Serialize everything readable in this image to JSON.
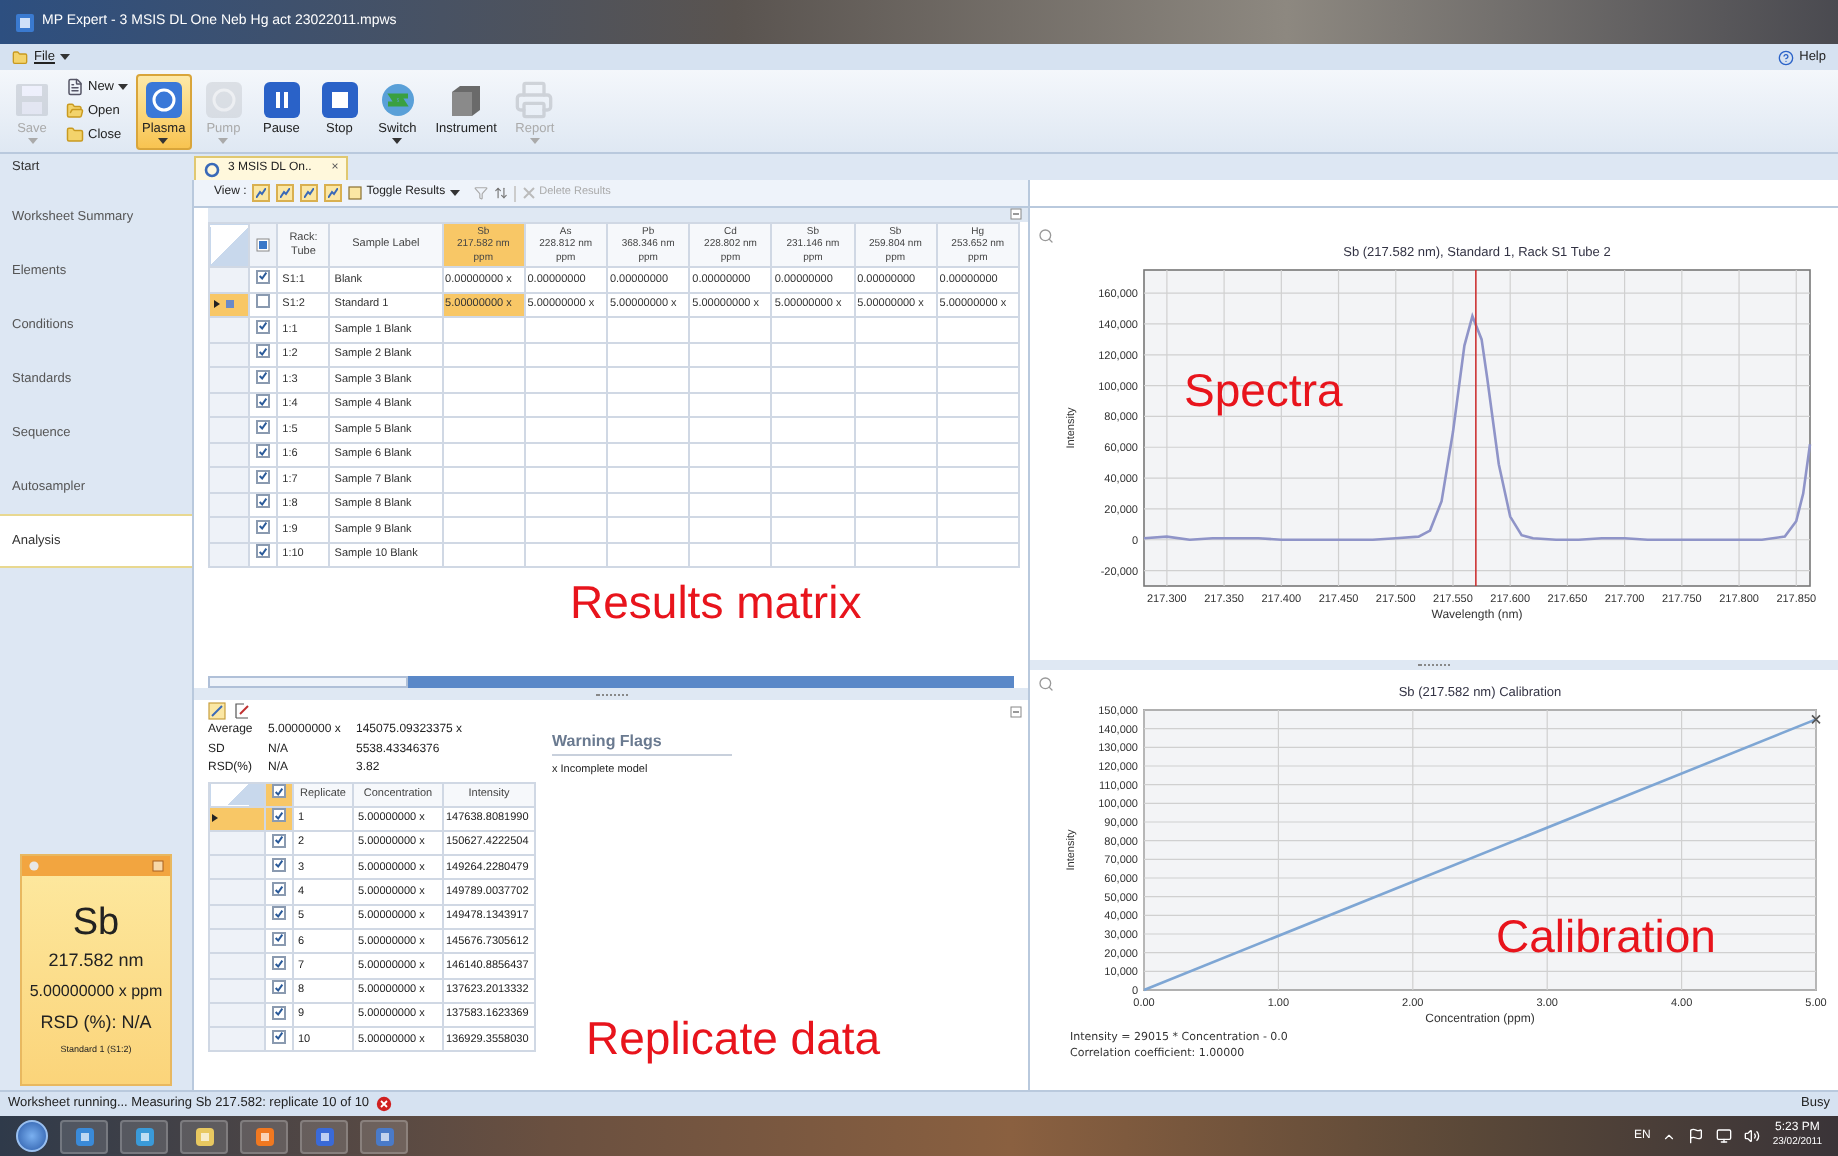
{
  "window": {
    "title": "MP Expert - 3 MSIS DL One Neb Hg act 23022011.mpws"
  },
  "menu": {
    "file": "File",
    "help": "Help"
  },
  "ribbon": {
    "buttons": [
      {
        "label": "Save",
        "kind": "large",
        "disabled": true,
        "selected": false,
        "dropdown": true
      },
      {
        "label": "New",
        "kind": "small",
        "disabled": false,
        "selected": false,
        "dropdown": true
      },
      {
        "label": "Open",
        "kind": "small",
        "disabled": false,
        "selected": false,
        "dropdown": false
      },
      {
        "label": "Close",
        "kind": "small",
        "disabled": false,
        "selected": false,
        "dropdown": false
      },
      {
        "label": "Plasma",
        "kind": "large",
        "disabled": false,
        "selected": true,
        "dropdown": true
      },
      {
        "label": "Pump",
        "kind": "large",
        "disabled": true,
        "selected": false,
        "dropdown": true
      },
      {
        "label": "Pause",
        "kind": "large",
        "disabled": false,
        "selected": false,
        "dropdown": false
      },
      {
        "label": "Stop",
        "kind": "large",
        "disabled": false,
        "selected": false,
        "dropdown": false
      },
      {
        "label": "Switch",
        "kind": "large",
        "disabled": false,
        "selected": false,
        "dropdown": true
      },
      {
        "label": "Instrument",
        "kind": "large",
        "disabled": false,
        "selected": false,
        "dropdown": false
      },
      {
        "label": "Report",
        "kind": "large",
        "disabled": true,
        "selected": false,
        "dropdown": true
      }
    ],
    "group_label": "Start"
  },
  "document_tab": {
    "label": "3 MSIS DL On..",
    "close": "×"
  },
  "sidebar": {
    "items": [
      {
        "label": "Worksheet Summary",
        "selected": false
      },
      {
        "label": "Elements",
        "selected": false
      },
      {
        "label": "Conditions",
        "selected": false
      },
      {
        "label": "Standards",
        "selected": false
      },
      {
        "label": "Sequence",
        "selected": false
      },
      {
        "label": "Autosampler",
        "selected": false
      },
      {
        "label": "Analysis",
        "selected": true
      }
    ]
  },
  "info_card": {
    "element": "Sb",
    "wavelength": "217.582 nm",
    "concentration": "5.00000000 x ppm",
    "rsd": "RSD (%): N/A",
    "sample": "Standard 1 (S1:2)"
  },
  "view_toolbar": {
    "label": "View :",
    "toggle": "Toggle Results",
    "delete": {
      "label": "Delete Results",
      "disabled": true
    }
  },
  "results": {
    "columns": [
      {
        "kind": "text",
        "label": "Rack: Tube"
      },
      {
        "kind": "text",
        "label": "Sample Label"
      },
      {
        "kind": "element",
        "element": "Sb",
        "wavelength": "217.582 nm",
        "unit": "ppm",
        "selected": true
      },
      {
        "kind": "element",
        "element": "As",
        "wavelength": "228.812 nm",
        "unit": "ppm",
        "selected": false
      },
      {
        "kind": "element",
        "element": "Pb",
        "wavelength": "368.346 nm",
        "unit": "ppm",
        "selected": false
      },
      {
        "kind": "element",
        "element": "Cd",
        "wavelength": "228.802 nm",
        "unit": "ppm",
        "selected": false
      },
      {
        "kind": "element",
        "element": "Sb",
        "wavelength": "231.146 nm",
        "unit": "ppm",
        "selected": false
      },
      {
        "kind": "element",
        "element": "Sb",
        "wavelength": "259.804 nm",
        "unit": "ppm",
        "selected": false
      },
      {
        "kind": "element",
        "element": "Hg",
        "wavelength": "253.652 nm",
        "unit": "ppm",
        "selected": false
      }
    ],
    "rows": [
      {
        "current": false,
        "checked": true,
        "rack": "S1:1",
        "label": "Blank",
        "values": [
          "0.00000000 x",
          "0.00000000",
          "0.00000000",
          "0.00000000",
          "0.00000000",
          "0.00000000",
          "0.00000000"
        ]
      },
      {
        "current": true,
        "checked": false,
        "rack": "S1:2",
        "label": "Standard 1",
        "values": [
          "5.00000000 x",
          "5.00000000 x",
          "5.00000000 x",
          "5.00000000 x",
          "5.00000000 x",
          "5.00000000 x",
          "5.00000000 x"
        ]
      },
      {
        "current": false,
        "checked": true,
        "rack": "1:1",
        "label": "Sample 1 Blank"
      },
      {
        "current": false,
        "checked": true,
        "rack": "1:2",
        "label": "Sample 2 Blank"
      },
      {
        "current": false,
        "checked": true,
        "rack": "1:3",
        "label": "Sample 3 Blank"
      },
      {
        "current": false,
        "checked": true,
        "rack": "1:4",
        "label": "Sample 4 Blank"
      },
      {
        "current": false,
        "checked": true,
        "rack": "1:5",
        "label": "Sample 5 Blank"
      },
      {
        "current": false,
        "checked": true,
        "rack": "1:6",
        "label": "Sample 6 Blank"
      },
      {
        "current": false,
        "checked": true,
        "rack": "1:7",
        "label": "Sample 7 Blank"
      },
      {
        "current": false,
        "checked": true,
        "rack": "1:8",
        "label": "Sample 8 Blank"
      },
      {
        "current": false,
        "checked": true,
        "rack": "1:9",
        "label": "Sample 9 Blank"
      },
      {
        "current": false,
        "checked": true,
        "rack": "1:10",
        "label": "Sample 10 Blank"
      }
    ]
  },
  "replicates": {
    "stats": [
      {
        "label": "Average",
        "concentration": "5.00000000 x",
        "intensity": "145075.09323375 x"
      },
      {
        "label": "SD",
        "concentration": "N/A",
        "intensity": "5538.43346376"
      },
      {
        "label": "RSD(%)",
        "concentration": "N/A",
        "intensity": "3.82"
      }
    ],
    "all_checked": true,
    "columns": [
      "Replicate",
      "Concentration",
      "Intensity"
    ],
    "rows": [
      {
        "current": true,
        "checked": true,
        "replicate": "1",
        "concentration": "5.00000000 x",
        "intensity": "147638.8081990"
      },
      {
        "current": false,
        "checked": true,
        "replicate": "2",
        "concentration": "5.00000000 x",
        "intensity": "150627.4222504"
      },
      {
        "current": false,
        "checked": true,
        "replicate": "3",
        "concentration": "5.00000000 x",
        "intensity": "149264.2280479"
      },
      {
        "current": false,
        "checked": true,
        "replicate": "4",
        "concentration": "5.00000000 x",
        "intensity": "149789.0037702"
      },
      {
        "current": false,
        "checked": true,
        "replicate": "5",
        "concentration": "5.00000000 x",
        "intensity": "149478.1343917"
      },
      {
        "current": false,
        "checked": true,
        "replicate": "6",
        "concentration": "5.00000000 x",
        "intensity": "145676.7305612"
      },
      {
        "current": false,
        "checked": true,
        "replicate": "7",
        "concentration": "5.00000000 x",
        "intensity": "146140.8856437"
      },
      {
        "current": false,
        "checked": true,
        "replicate": "8",
        "concentration": "5.00000000 x",
        "intensity": "137623.2013332"
      },
      {
        "current": false,
        "checked": true,
        "replicate": "9",
        "concentration": "5.00000000 x",
        "intensity": "137583.1623369"
      },
      {
        "current": false,
        "checked": true,
        "replicate": "10",
        "concentration": "5.00000000 x",
        "intensity": "136929.3558030"
      }
    ],
    "warning_title": "Warning Flags",
    "warnings": [
      "x Incomplete model"
    ]
  },
  "spectra": {
    "chart_data": {
      "type": "line",
      "title": "Sb (217.582 nm), Standard 1, Rack S1 Tube 2",
      "xlabel": "Wavelength (nm)",
      "ylabel": "Intensity",
      "x": [
        217.28,
        217.3,
        217.32,
        217.34,
        217.36,
        217.38,
        217.4,
        217.42,
        217.44,
        217.46,
        217.48,
        217.5,
        217.52,
        217.53,
        217.54,
        217.55,
        217.56,
        217.567,
        217.575,
        217.58,
        217.59,
        217.6,
        217.61,
        217.62,
        217.64,
        217.66,
        217.68,
        217.7,
        217.72,
        217.74,
        217.76,
        217.78,
        217.8,
        217.82,
        217.84,
        217.85,
        217.856,
        217.862
      ],
      "series": [
        {
          "color": "#8f94c8",
          "values": [
            1000,
            2000,
            0,
            1000,
            1000,
            1000,
            0,
            0,
            0,
            0,
            0,
            1000,
            2000,
            6000,
            25000,
            70000,
            126000,
            145000,
            130000,
            105000,
            49000,
            15000,
            3000,
            1000,
            0,
            0,
            1000,
            1000,
            0,
            0,
            0,
            0,
            0,
            0,
            2000,
            12000,
            30000,
            62000
          ]
        }
      ],
      "grid": true,
      "xlim": [
        217.28,
        217.862
      ],
      "ylim": [
        -30000,
        175000
      ],
      "xticks": [
        {
          "value": 217.3,
          "label": "217.300"
        },
        {
          "value": 217.35,
          "label": "217.350"
        },
        {
          "value": 217.4,
          "label": "217.400"
        },
        {
          "value": 217.45,
          "label": "217.450"
        },
        {
          "value": 217.5,
          "label": "217.500"
        },
        {
          "value": 217.55,
          "label": "217.550"
        },
        {
          "value": 217.6,
          "label": "217.600"
        },
        {
          "value": 217.65,
          "label": "217.650"
        },
        {
          "value": 217.7,
          "label": "217.700"
        },
        {
          "value": 217.75,
          "label": "217.750"
        },
        {
          "value": 217.8,
          "label": "217.800"
        },
        {
          "value": 217.85,
          "label": "217.850"
        }
      ],
      "yticks": [
        {
          "value": -20000,
          "label": "-20,000"
        },
        {
          "value": 0,
          "label": "0"
        },
        {
          "value": 20000,
          "label": "20,000"
        },
        {
          "value": 40000,
          "label": "40,000"
        },
        {
          "value": 60000,
          "label": "60,000"
        },
        {
          "value": 80000,
          "label": "80,000"
        },
        {
          "value": 100000,
          "label": "100,000"
        },
        {
          "value": 120000,
          "label": "120,000"
        },
        {
          "value": 140000,
          "label": "140,000"
        },
        {
          "value": 160000,
          "label": "160,000"
        }
      ],
      "ref_lines": [
        {
          "axis": "x",
          "value": 217.57,
          "color": "#cc3333"
        }
      ]
    }
  },
  "calibration": {
    "chart_data": {
      "type": "line",
      "title": "Sb (217.582 nm) Calibration",
      "xlabel": "Concentration (ppm)",
      "ylabel": "Intensity",
      "x": [
        0,
        5
      ],
      "series": [
        {
          "color": "#7ea6d4",
          "values": [
            0,
            145000
          ]
        }
      ],
      "grid": true,
      "xlim": [
        0,
        5
      ],
      "ylim": [
        0,
        150000
      ],
      "xticks": [
        {
          "value": 0,
          "label": "0.00"
        },
        {
          "value": 1,
          "label": "1.00"
        },
        {
          "value": 2,
          "label": "2.00"
        },
        {
          "value": 3,
          "label": "3.00"
        },
        {
          "value": 4,
          "label": "4.00"
        },
        {
          "value": 5,
          "label": "5.00"
        }
      ],
      "yticks": [
        {
          "value": 0,
          "label": "0"
        },
        {
          "value": 10000,
          "label": "10,000"
        },
        {
          "value": 20000,
          "label": "20,000"
        },
        {
          "value": 30000,
          "label": "30,000"
        },
        {
          "value": 40000,
          "label": "40,000"
        },
        {
          "value": 50000,
          "label": "50,000"
        },
        {
          "value": 60000,
          "label": "60,000"
        },
        {
          "value": 70000,
          "label": "70,000"
        },
        {
          "value": 80000,
          "label": "80,000"
        },
        {
          "value": 90000,
          "label": "90,000"
        },
        {
          "value": 100000,
          "label": "100,000"
        },
        {
          "value": 110000,
          "label": "110,000"
        },
        {
          "value": 120000,
          "label": "120,000"
        },
        {
          "value": 130000,
          "label": "130,000"
        },
        {
          "value": 140000,
          "label": "140,000"
        },
        {
          "value": 150000,
          "label": "150,000"
        }
      ],
      "marker": "x"
    },
    "equation": "Intensity = 29015 * Concentration - 0.0",
    "correlation": "Correlation coefficient: 1.00000"
  },
  "overlay_labels": [
    "Results matrix",
    "Spectra",
    "Replicate data",
    "Calibration"
  ],
  "status_bar": {
    "message": "Worksheet running... Measuring Sb 217.582: replicate 10 of 10",
    "state": "Busy"
  },
  "taskbar": {
    "language": "EN",
    "time": "5:23 PM",
    "date": "23/02/2011"
  }
}
